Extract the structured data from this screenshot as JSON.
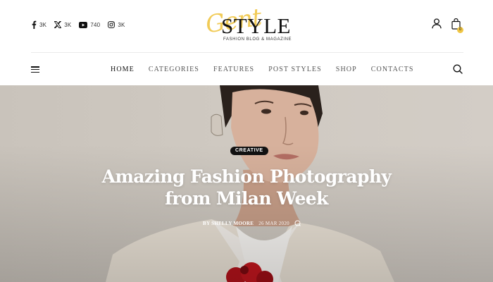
{
  "social": [
    {
      "icon": "facebook-icon",
      "count": "3K"
    },
    {
      "icon": "x-twitter-icon",
      "count": "3K"
    },
    {
      "icon": "youtube-icon",
      "count": "740"
    },
    {
      "icon": "instagram-icon",
      "count": "3K"
    }
  ],
  "logo": {
    "script": "Gent",
    "main": "STYLE",
    "tagline": "FASHION BLOG & MAGAZINE",
    "accent_color": "#f0c645"
  },
  "header": {
    "cart_count": "0"
  },
  "nav": {
    "items": [
      "HOME",
      "CATEGORIES",
      "FEATURES",
      "POST STYLES",
      "SHOP",
      "CONTACTS"
    ],
    "active_index": 0
  },
  "hero": {
    "category": "CREATIVE",
    "title_line1": "Amazing Fashion Photography",
    "title_line2": "from Milan Week",
    "author": "BY SHELLY MOORE",
    "date": "26 MAR 2020"
  },
  "colors": {
    "accent": "#f0c645",
    "badge_bg": "#111111",
    "hero_bg": "#cfc9c1"
  }
}
